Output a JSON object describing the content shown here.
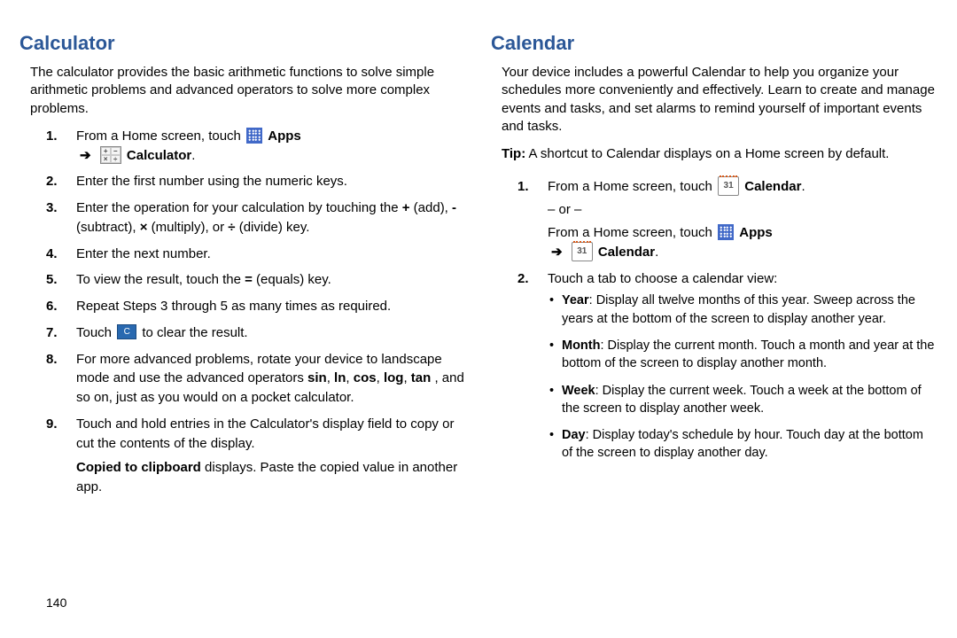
{
  "left": {
    "heading": "Calculator",
    "intro": "The calculator provides the basic arithmetic functions to solve simple arithmetic problems and advanced operators to solve more complex problems.",
    "step1_a": "From a Home screen, touch ",
    "apps_label": "Apps",
    "calc_label": "Calculator",
    "step2": "Enter the first number using the numeric keys.",
    "step3_a": "Enter the operation for your calculation by touching the ",
    "step3_plus": "+",
    "step3_add": " (add), ",
    "step3_minus": "-",
    "step3_sub": " (subtract), ",
    "step3_times": "×",
    "step3_mul": " (multiply), or ",
    "step3_div": "÷",
    "step3_divw": " (divide) key.",
    "step4": "Enter the next number.",
    "step5_a": "To view the result, touch the ",
    "step5_eq": "=",
    "step5_b": " (equals) key.",
    "step6": "Repeat Steps 3 through 5 as many times as required.",
    "step7_a": "Touch ",
    "step7_b": " to clear the result.",
    "c_key": "C",
    "step8_a": "For more advanced problems, rotate your device to landscape mode and use the advanced operators ",
    "step8_sin": "sin",
    "step8_c1": ", ",
    "step8_ln": "ln",
    "step8_c2": ", ",
    "step8_cos": "cos",
    "step8_c3": ", ",
    "step8_log": "log",
    "step8_c4": ", ",
    "step8_tan": "tan",
    "step8_b": ", and so on, just as you would on a pocket calculator.",
    "step9_a": "Touch and hold entries in the Calculator's display field to copy or cut the contents of the display.",
    "step9_b1": "Copied to clipboard",
    "step9_b2": " displays. Paste the copied value in another app."
  },
  "right": {
    "heading": "Calendar",
    "intro": "Your device includes a powerful Calendar to help you organize your schedules more conveniently and effectively. Learn to create and manage events and tasks, and set alarms to remind yourself of important events and tasks.",
    "tip_label": "Tip:",
    "tip_text": " A shortcut to Calendar displays on a Home screen by default.",
    "step1_a": "From a Home screen, touch ",
    "calendar_label": "Calendar",
    "step1_or": "– or –",
    "step1_b": "From a Home screen, touch ",
    "apps_label": "Apps",
    "cal_day": "31",
    "step2_intro": "Touch a tab to choose a calendar view:",
    "year_l": "Year",
    "year_t": ": Display all twelve months of this year. Sweep across the years at the bottom of the screen to display another year.",
    "month_l": "Month",
    "month_t": ": Display the current month. Touch a month and year at the bottom of the screen to display another month.",
    "week_l": "Week",
    "week_t": ": Display the current week. Touch a week at the bottom of the screen to display another week.",
    "day_l": "Day",
    "day_t": ": Display today's schedule by hour. Touch day at the bottom of the screen to display another day."
  },
  "page_number": "140",
  "arrow": "➔",
  "period": "."
}
